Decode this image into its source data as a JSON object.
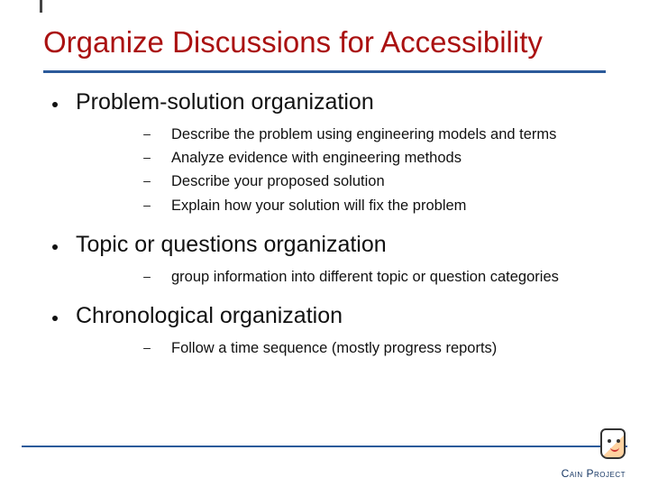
{
  "title": "Organize Discussions for Accessibility",
  "items": [
    {
      "label": "Problem-solution organization",
      "sub": [
        "Describe the problem using engineering models and terms",
        "Analyze evidence with engineering methods",
        "Describe your proposed solution",
        "Explain how your solution will fix the problem"
      ]
    },
    {
      "label": "Topic or questions organization",
      "sub": [
        "group information into different topic or question categories"
      ]
    },
    {
      "label": "Chronological organization",
      "sub": [
        "Follow a time sequence (mostly progress reports)"
      ]
    }
  ],
  "logo_text": "Cain Project"
}
